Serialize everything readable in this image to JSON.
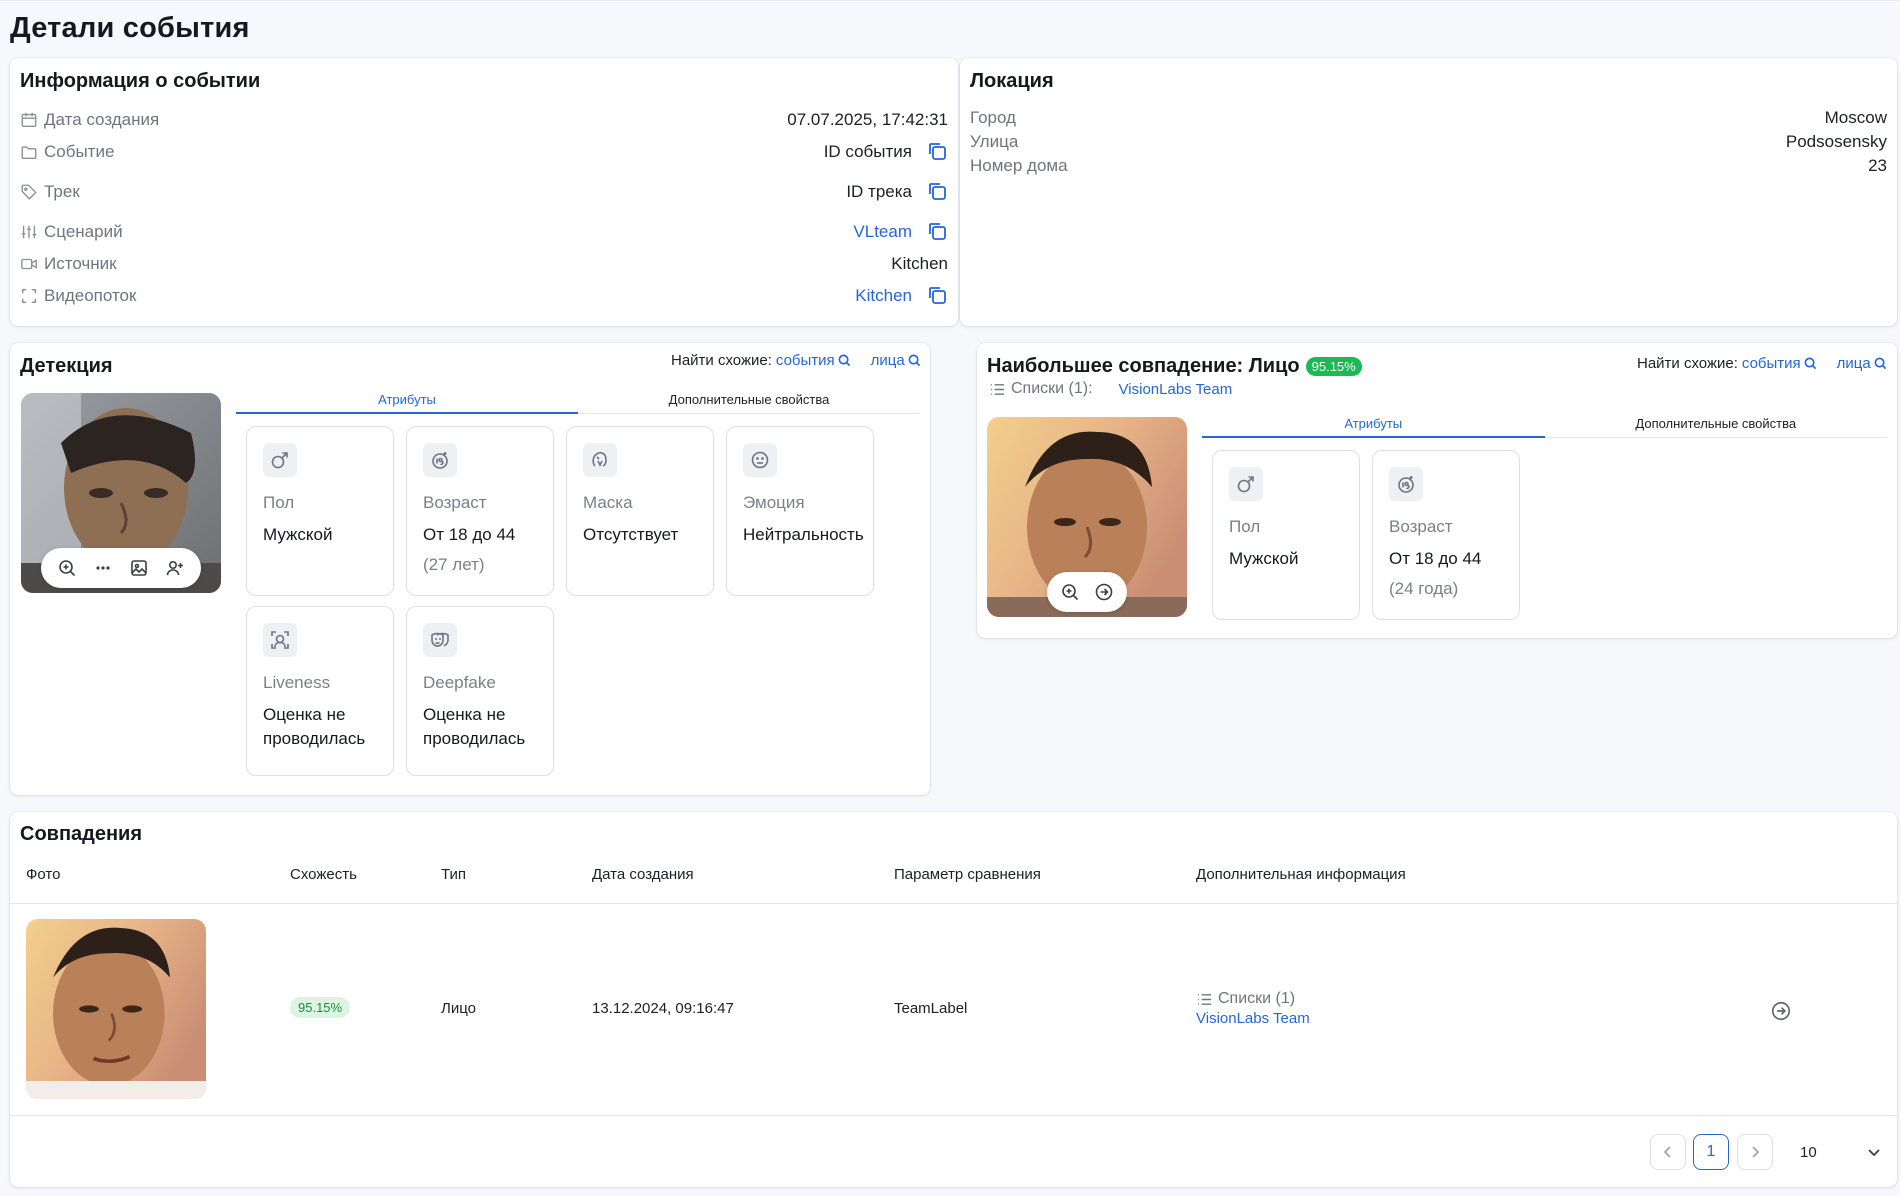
{
  "page": {
    "title": "Детали события"
  },
  "event_info": {
    "title": "Информация о событии",
    "rows": [
      {
        "label": "Дата создания",
        "value": "07.07.2025, 17:42:31"
      },
      {
        "label": "Событие",
        "value": "ID события"
      },
      {
        "label": "Трек",
        "value": "ID трека"
      },
      {
        "label": "Сценарий",
        "value": "VLteam"
      },
      {
        "label": "Источник",
        "value": "Kitchen"
      },
      {
        "label": "Видеопоток",
        "value": "Kitchen"
      }
    ]
  },
  "location": {
    "title": "Локация",
    "rows": [
      {
        "label": "Город",
        "value": "Moscow"
      },
      {
        "label": "Улица",
        "value": "Podsosensky"
      },
      {
        "label": "Номер дома",
        "value": "23"
      }
    ]
  },
  "detection": {
    "title": "Детекция",
    "find_similar": {
      "label": "Найти схожие:",
      "events": "события",
      "faces": "лица"
    },
    "tabs": [
      "Атрибуты",
      "Дополнительные свойства"
    ],
    "attributes": [
      {
        "icon": "gender-male-icon",
        "name": "Пол",
        "value": "Мужской",
        "sub": ""
      },
      {
        "icon": "age-18-icon",
        "name": "Возраст",
        "value": "От 18 до 44",
        "sub": "(27 лет)"
      },
      {
        "icon": "mask-icon",
        "name": "Маска",
        "value": "Отсутствует",
        "sub": ""
      },
      {
        "icon": "emotion-icon",
        "name": "Эмоция",
        "value": "Нейтральность",
        "sub": ""
      },
      {
        "icon": "liveness-icon",
        "name": "Liveness",
        "value": "Оценка не проводилась",
        "sub": ""
      },
      {
        "icon": "deepfake-icon",
        "name": "Deepfake",
        "value": "Оценка не проводилась",
        "sub": ""
      }
    ]
  },
  "best_match": {
    "title": "Наибольшее совпадение: Лицо",
    "score": "95.15%",
    "lists_label": "Списки (1):",
    "list_name": "VisionLabs Team",
    "find_similar": {
      "label": "Найти схожие:",
      "events": "события",
      "faces": "лица"
    },
    "tabs": [
      "Атрибуты",
      "Дополнительные свойства"
    ],
    "attributes": [
      {
        "icon": "gender-male-icon",
        "name": "Пол",
        "value": "Мужской",
        "sub": ""
      },
      {
        "icon": "age-18-icon",
        "name": "Возраст",
        "value": "От 18 до 44",
        "sub": "(24 года)"
      }
    ]
  },
  "matches": {
    "title": "Совпадения",
    "columns": [
      "Фото",
      "Схожесть",
      "Тип",
      "Дата создания",
      "Параметр сравнения",
      "Дополнительная информация"
    ],
    "rows": [
      {
        "similarity": "95.15%",
        "type": "Лицо",
        "created": "13.12.2024, 09:16:47",
        "param": "TeamLabel",
        "lists": "Списки (1)",
        "list_name": "VisionLabs Team"
      }
    ],
    "pagination": {
      "current": "1",
      "page_size": "10"
    }
  },
  "colors": {
    "accent": "#2367d6",
    "success": "#1db954",
    "background": "#f6f8fc"
  }
}
